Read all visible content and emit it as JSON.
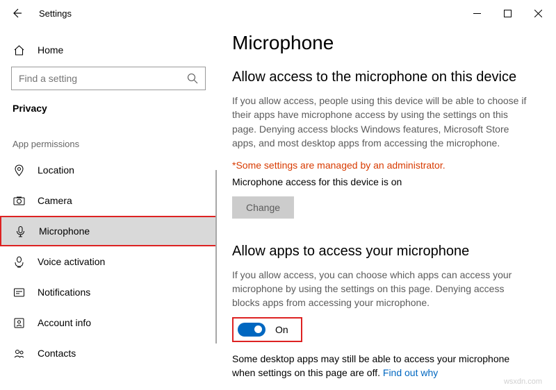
{
  "window": {
    "title": "Settings"
  },
  "sidebar": {
    "home_label": "Home",
    "search_placeholder": "Find a setting",
    "crumb": "Privacy",
    "section_label": "App permissions",
    "items": [
      {
        "label": "Location"
      },
      {
        "label": "Camera"
      },
      {
        "label": "Microphone"
      },
      {
        "label": "Voice activation"
      },
      {
        "label": "Notifications"
      },
      {
        "label": "Account info"
      },
      {
        "label": "Contacts"
      }
    ]
  },
  "content": {
    "page_title": "Microphone",
    "section1": {
      "heading": "Allow access to the microphone on this device",
      "body": "If you allow access, people using this device will be able to choose if their apps have microphone access by using the settings on this page. Denying access blocks Windows features, Microsoft Store apps, and most desktop apps from accessing the microphone.",
      "admin_warning": "*Some settings are managed by an administrator.",
      "status": "Microphone access for this device is on",
      "change_label": "Change"
    },
    "section2": {
      "heading": "Allow apps to access your microphone",
      "body": "If you allow access, you can choose which apps can access your microphone by using the settings on this page. Denying access blocks apps from accessing your microphone.",
      "toggle_label": "On",
      "desktop_note": "Some desktop apps may still be able to access your microphone when settings on this page are off. ",
      "link_text": "Find out why"
    }
  },
  "watermark": "wsxdn.com"
}
